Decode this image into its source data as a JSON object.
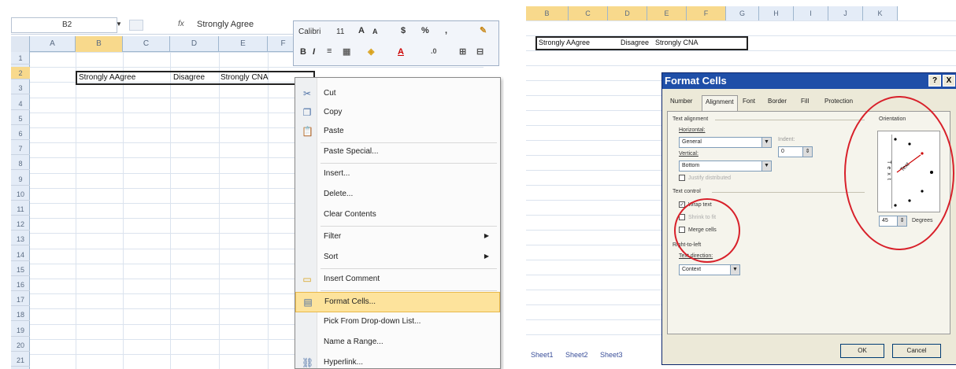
{
  "left": {
    "name_box": "B2",
    "fx_label": "fx",
    "formula_value": "Strongly Agree",
    "columns": [
      "A",
      "B",
      "C",
      "D",
      "E",
      "F"
    ],
    "rows": [
      "1",
      "2",
      "3",
      "4",
      "5",
      "6",
      "7",
      "8",
      "9",
      "10",
      "11",
      "12",
      "13",
      "14",
      "15",
      "16",
      "17",
      "18",
      "19",
      "20",
      "21"
    ],
    "cell_text": "Strongly AAgree",
    "cell_text2": "Disagree",
    "cell_text3": "Strongly CNA",
    "mini_toolbar": {
      "font": "Calibri",
      "size": "11",
      "grow": "A",
      "shrink": "A",
      "currency": "$",
      "percent": "%",
      "comma": ",",
      "bold": "B",
      "italic": "I",
      "font_color": "A"
    },
    "menu": [
      {
        "label": "Cut",
        "icon": "scissors-icon"
      },
      {
        "label": "Copy",
        "icon": "copy-icon"
      },
      {
        "label": "Paste",
        "icon": "paste-icon"
      },
      {
        "label": "Paste Special...",
        "icon": ""
      },
      {
        "label": "Insert...",
        "icon": ""
      },
      {
        "label": "Delete...",
        "icon": ""
      },
      {
        "label": "Clear Contents",
        "icon": ""
      },
      {
        "label": "Filter",
        "icon": "",
        "submenu": true
      },
      {
        "label": "Sort",
        "icon": "",
        "submenu": true
      },
      {
        "label": "Insert Comment",
        "icon": "comment-icon"
      },
      {
        "label": "Format Cells...",
        "icon": "format-cells-icon",
        "highlight": true
      },
      {
        "label": "Pick From Drop-down List...",
        "icon": ""
      },
      {
        "label": "Name a Range...",
        "icon": ""
      },
      {
        "label": "Hyperlink...",
        "icon": "hyperlink-icon"
      }
    ]
  },
  "right": {
    "columns": [
      "B",
      "C",
      "D",
      "E",
      "F",
      "G",
      "H",
      "I",
      "J",
      "K"
    ],
    "cell_text": "Strongly AAgree",
    "cell_text2": "Disagree",
    "cell_text3": "Strongly CNA",
    "sheet_tabs": [
      "Sheet1",
      "Sheet2",
      "Sheet3"
    ],
    "dialog": {
      "title": "Format Cells",
      "help": "?",
      "close": "X",
      "tabs": [
        "Number",
        "Alignment",
        "Font",
        "Border",
        "Fill",
        "Protection"
      ],
      "text_alignment": "Text alignment",
      "horizontal_label": "Horizontal:",
      "horizontal_value": "General",
      "indent_label": "Indent:",
      "indent_value": "0",
      "vertical_label": "Vertical:",
      "vertical_value": "Bottom",
      "justify_distributed": "Justify distributed",
      "text_control": "Text control",
      "wrap_text": "Wrap text",
      "shrink_to_fit": "Shrink to fit",
      "merge_cells": "Merge cells",
      "right_to_left": "Right-to-left",
      "text_direction_label": "Text direction:",
      "text_direction_value": "Context",
      "orientation": "Orientation",
      "orientation_vertical_text": "Text",
      "orientation_text": "Text",
      "degrees_value": "45",
      "degrees_label": "Degrees",
      "ok": "OK",
      "cancel": "Cancel"
    }
  }
}
